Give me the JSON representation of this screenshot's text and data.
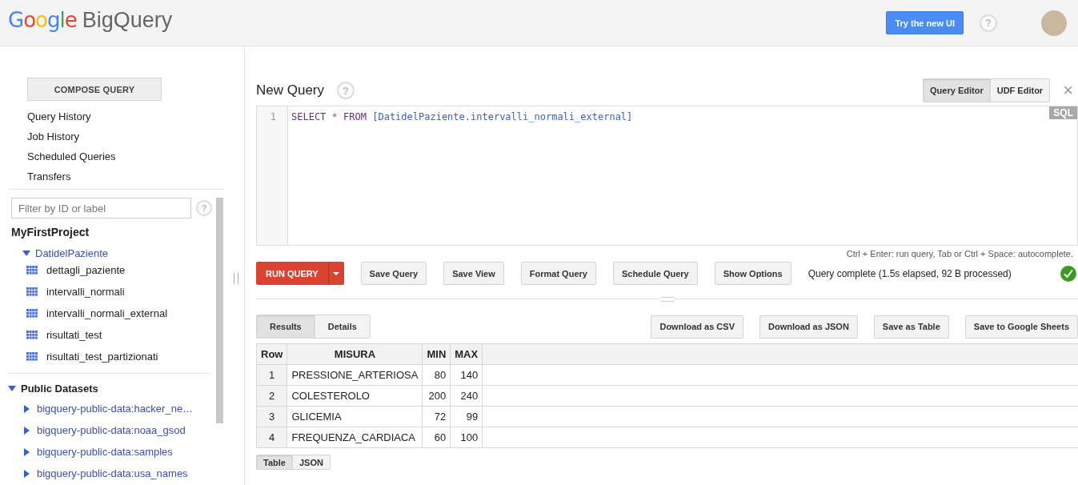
{
  "header": {
    "logo_brand": "Google",
    "logo_product": "BigQuery",
    "try_button": "Try the new UI",
    "help": "?"
  },
  "sidebar": {
    "compose_button": "COMPOSE QUERY",
    "nav": [
      "Query History",
      "Job History",
      "Scheduled Queries",
      "Transfers"
    ],
    "filter": {
      "placeholder": "Filter by ID or label"
    },
    "filter_help": "?",
    "project": {
      "name": "MyFirstProject",
      "datasets": [
        {
          "name": "DatidelPaziente",
          "expanded": true,
          "children": [
            {
              "name": "dettagli_paziente"
            },
            {
              "name": "intervalli_normali"
            },
            {
              "name": "intervalli_normali_external"
            },
            {
              "name": "risultati_test"
            },
            {
              "name": "risultati_test_partizionati"
            }
          ]
        }
      ]
    },
    "public": {
      "name": "Public Datasets",
      "expanded": true,
      "children": [
        {
          "name": "bigquery-public-data:hacker_ne…",
          "expanded": false
        },
        {
          "name": "bigquery-public-data:noaa_gsod",
          "expanded": false
        },
        {
          "name": "bigquery-public-data:samples",
          "expanded": false
        },
        {
          "name": "bigquery-public-data:usa_names",
          "expanded": false
        }
      ]
    }
  },
  "query": {
    "title": "New Query",
    "help": "?",
    "editor_tabs": [
      {
        "label": "Query Editor",
        "selected": true
      },
      {
        "label": "UDF Editor",
        "selected": false
      }
    ],
    "close": "×",
    "editor": {
      "lines": [
        {
          "number": "1",
          "tokens": [
            {
              "kind": "keyword",
              "text": "SELECT"
            },
            {
              "kind": "operator",
              "text": "*"
            },
            {
              "kind": "keyword",
              "text": "FROM"
            },
            {
              "kind": "identifier",
              "text": "[DatidelPaziente.intervalli_normali_external]"
            }
          ]
        }
      ],
      "badge": "SQL"
    },
    "hint": "Ctrl + Enter: run query, Tab or Ctrl + Space: autocomplete.",
    "run_button": "RUN QUERY",
    "buttons": [
      "Save Query",
      "Save View",
      "Format Query",
      "Schedule Query",
      "Show Options"
    ],
    "status": "Query complete (1.5s elapsed, 92 B processed)",
    "status_ok": true
  },
  "results": {
    "tabs": [
      {
        "label": "Results",
        "selected": true
      },
      {
        "label": "Details",
        "selected": false
      }
    ],
    "actions": [
      "Download as CSV",
      "Download as JSON",
      "Save as Table",
      "Save to Google Sheets"
    ],
    "table": {
      "columns": [
        "Row",
        "MISURA",
        "MIN",
        "MAX"
      ],
      "rows": [
        [
          "1",
          "PRESSIONE_ARTERIOSA",
          "80",
          "140"
        ],
        [
          "2",
          "COLESTEROLO",
          "200",
          "240"
        ],
        [
          "3",
          "GLICEMIA",
          "72",
          "99"
        ],
        [
          "4",
          "FREQUENZA_CARDIACA",
          "60",
          "100"
        ]
      ]
    },
    "view_tabs": [
      {
        "label": "Table",
        "selected": true
      },
      {
        "label": "JSON",
        "selected": false
      }
    ]
  }
}
